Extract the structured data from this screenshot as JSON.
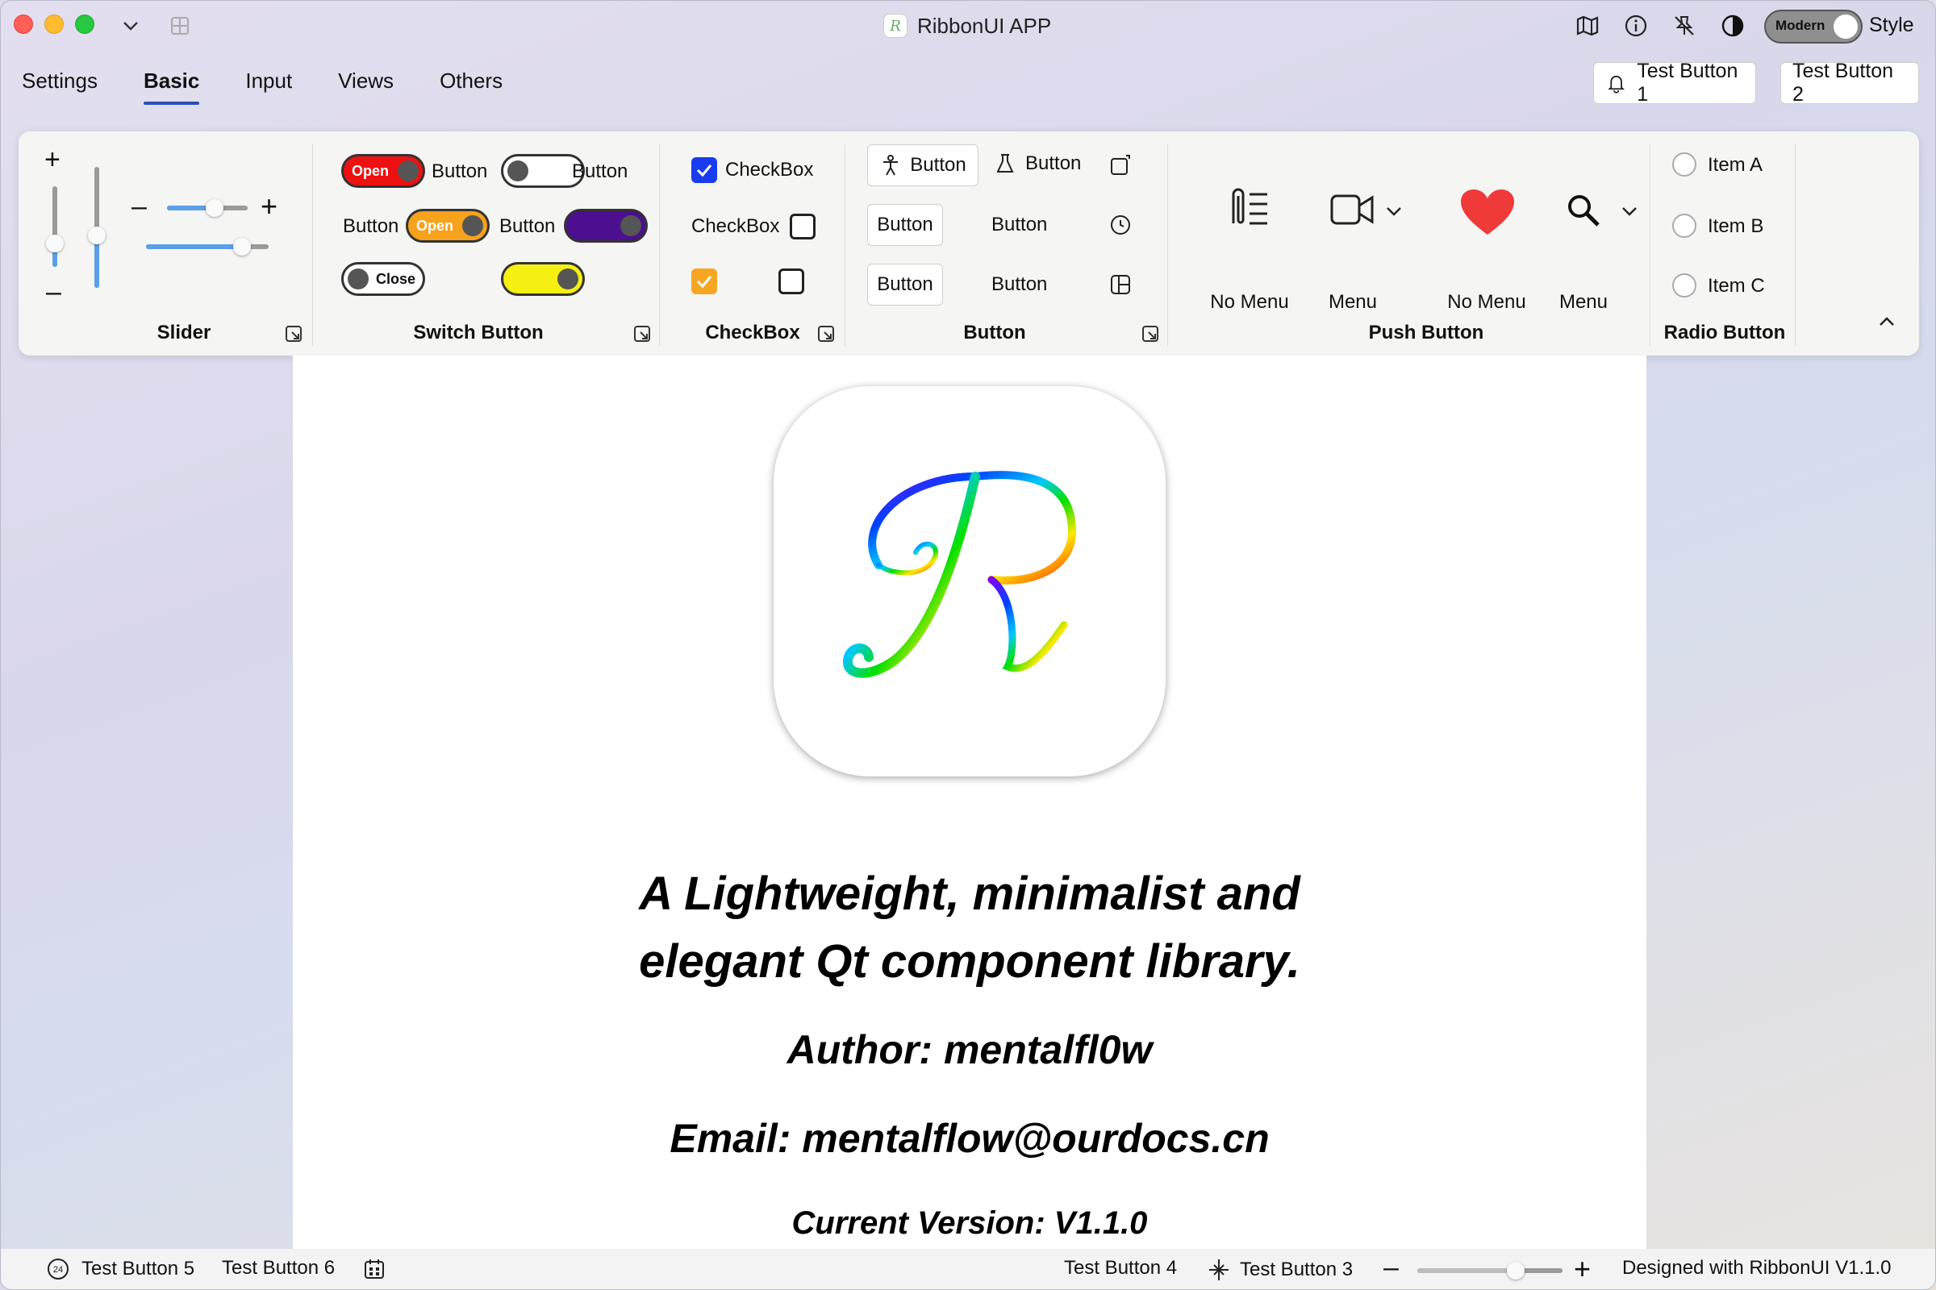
{
  "window": {
    "title": "RibbonUI APP",
    "style_toggle_label": "Modern",
    "style_label": "Style"
  },
  "tabs": [
    {
      "label": "Settings"
    },
    {
      "label": "Basic"
    },
    {
      "label": "Input"
    },
    {
      "label": "Views"
    },
    {
      "label": "Others"
    }
  ],
  "top_buttons": {
    "btn1": "Test Button 1",
    "btn2": "Test Button 2"
  },
  "groups": {
    "slider": {
      "title": "Slider",
      "plus": "+",
      "minus": "–"
    },
    "switch": {
      "title": "Switch Button",
      "sw1_text": "Open",
      "sw1_label": "Button",
      "sw2_label": "Button",
      "sw3_prefix": "Button",
      "sw3_text": "Open",
      "sw4_prefix": "Button",
      "sw5_text": "Close"
    },
    "checkbox": {
      "title": "CheckBox",
      "cb1_label": "CheckBox",
      "cb2_label": "CheckBox"
    },
    "button": {
      "title": "Button",
      "b1": "Button",
      "b2": "Button",
      "b3": "Button",
      "b4": "Button",
      "b5": "Button",
      "b6": "Button"
    },
    "push": {
      "title": "Push Button",
      "p1": "No Menu",
      "p2": "Menu",
      "p3": "No Menu",
      "p4": "Menu"
    },
    "radio": {
      "title": "Radio Button",
      "r1": "Item A",
      "r2": "Item B",
      "r3": "Item C"
    }
  },
  "content": {
    "headline_line1": "A Lightweight, minimalist and",
    "headline_line2": "elegant Qt component library.",
    "author": "Author: mentalfl0w",
    "email": "Email: mentalflow@ourdocs.cn",
    "version": "Current Version: V1.1.0"
  },
  "statusbar": {
    "b5": "Test Button 5",
    "b6": "Test Button 6",
    "b4": "Test Button 4",
    "b3": "Test Button 3",
    "designed": "Designed with RibbonUI V1.1.0",
    "badge": "24",
    "zoom_level": 0.68
  },
  "colors": {
    "accent": "#2b4fb3",
    "slider_fill": "#5a9fe8",
    "switch_red": "#ee1111",
    "switch_orange": "#f6a21c",
    "switch_purple": "#4b0f8f",
    "switch_yellow": "#f5f012",
    "checkbox_blue": "#1a3cf0",
    "checkbox_orange": "#f6a623",
    "heart": "#f03a3a"
  }
}
